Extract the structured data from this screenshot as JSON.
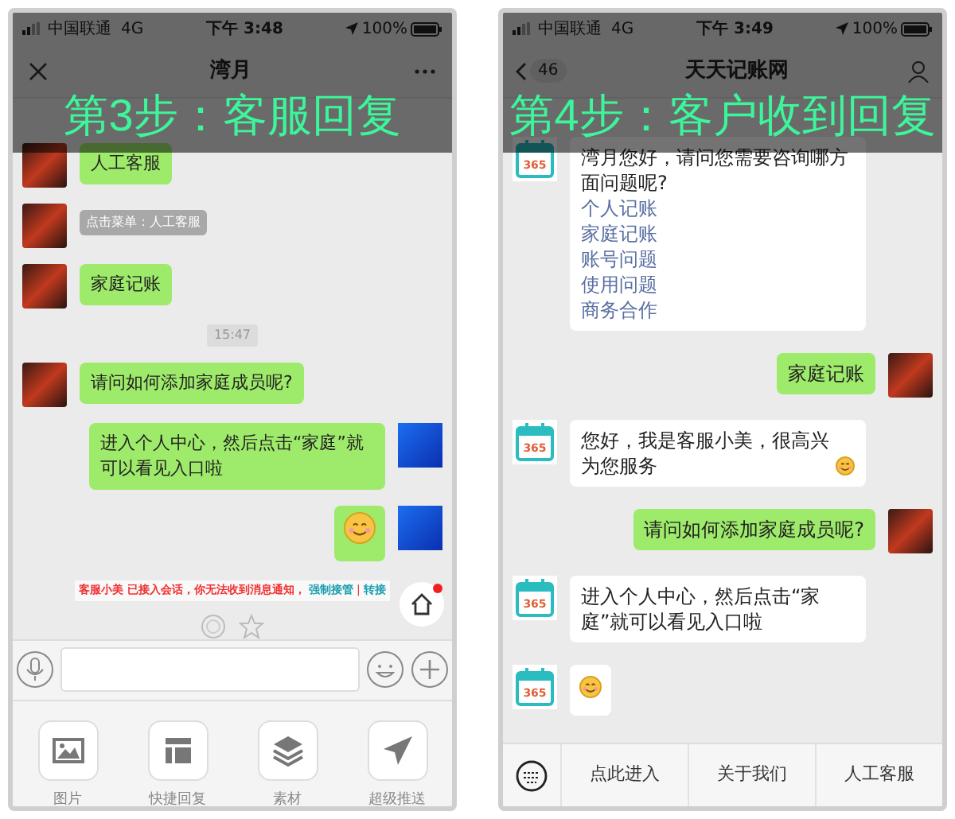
{
  "left_phone": {
    "caption": "第3步：客服回复",
    "status_bar": {
      "carrier": "中国联通",
      "network": "4G",
      "time": "下午 3:48",
      "battery": "100%"
    },
    "nav": {
      "title": "湾月"
    },
    "messages": [
      {
        "kind": "bubble",
        "outgoing": false,
        "color": "#9eea6a",
        "text": "人工客服"
      },
      {
        "kind": "note",
        "outgoing": false,
        "text": "点击菜单：人工客服"
      },
      {
        "kind": "bubble",
        "outgoing": false,
        "color": "#9eea6a",
        "text": "家庭记账"
      },
      {
        "kind": "time",
        "text": "15:47"
      },
      {
        "kind": "bubble",
        "outgoing": false,
        "color": "#9eea6a",
        "text": "请问如何添加家庭成员呢?"
      },
      {
        "kind": "bubble",
        "outgoing": true,
        "color": "#9eea6a",
        "text": "进入个人中心，然后点击“家庭”就可以看见入口啦"
      },
      {
        "kind": "emoji",
        "outgoing": true,
        "color": "#9eea6a"
      }
    ],
    "notice": {
      "text": "客服小美 已接入会话，你无法收到消息通知，",
      "links": [
        "强制接管",
        "转接"
      ],
      "separator": "|"
    },
    "home_button": {
      "badge": true
    },
    "tools": [
      {
        "label": "图片"
      },
      {
        "label": "快捷回复"
      },
      {
        "label": "素材"
      },
      {
        "label": "超级推送"
      }
    ]
  },
  "right_phone": {
    "caption": "第4步：客户收到回复",
    "status_bar": {
      "carrier": "中国联通",
      "network": "4G",
      "time": "下午 3:49",
      "battery": "100%"
    },
    "nav": {
      "back_count": "46",
      "title": "天天记账网"
    },
    "messages": [
      {
        "kind": "card",
        "outgoing": false,
        "avatar_label": "365",
        "color": "#ffffff",
        "text": "湾月您好，请问您需要咨询哪方面问题呢?",
        "links": [
          "个人记账",
          "家庭记账",
          "账号问题",
          "使用问题",
          "商务合作"
        ]
      },
      {
        "kind": "bubble",
        "outgoing": true,
        "color": "#9eea6a",
        "text": "家庭记账"
      },
      {
        "kind": "bubble",
        "outgoing": false,
        "avatar_label": "365",
        "color": "#ffffff",
        "text": "您好，我是客服小美，很高兴为您服务",
        "emoji": true
      },
      {
        "kind": "bubble",
        "outgoing": true,
        "color": "#9eea6a",
        "text": "请问如何添加家庭成员呢?"
      },
      {
        "kind": "bubble",
        "outgoing": false,
        "avatar_label": "365",
        "color": "#ffffff",
        "text": "进入个人中心，然后点击“家庭”就可以看见入口啦"
      },
      {
        "kind": "emoji",
        "outgoing": false,
        "avatar_label": "365",
        "color": "#ffffff"
      }
    ],
    "menu": [
      "点此进入",
      "关于我们",
      "人工客服"
    ]
  }
}
